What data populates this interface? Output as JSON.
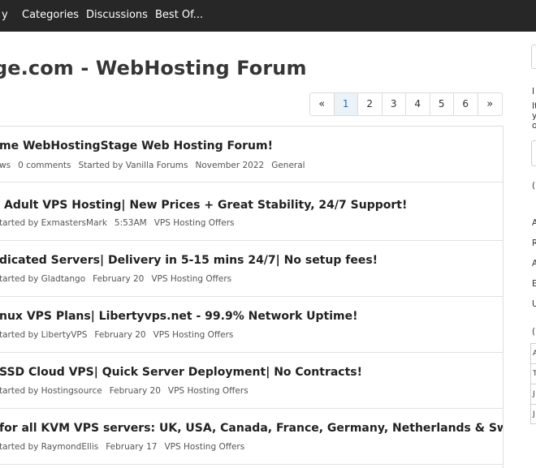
{
  "nav": {
    "items": [
      "y",
      "Categories",
      "Discussions",
      "Best Of..."
    ]
  },
  "page": {
    "title": "ge.com - WebHosting Forum"
  },
  "pager": {
    "prev": "«",
    "pages": [
      "1",
      "2",
      "3",
      "4",
      "5",
      "6"
    ],
    "next": "»",
    "current": "1"
  },
  "discussions": [
    {
      "title": "me WebHostingStage Web Hosting Forum!",
      "meta": [
        "ws",
        "0 comments",
        "Started by Vanilla Forums",
        "November 2022",
        "General"
      ]
    },
    {
      "title": "Adult VPS Hosting| New Prices + Great Stability, 24/7 Support!",
      "meta": [
        "tarted by ExmastersMark",
        "5:53AM",
        "VPS Hosting Offers"
      ]
    },
    {
      "title": "dicated Servers| Delivery in 5-15 mins 24/7| No setup fees!",
      "meta": [
        "tarted by Gladtango",
        "February 20",
        "VPS Hosting Offers"
      ]
    },
    {
      "title": "nux VPS Plans| Libertyvps.net - 99.9% Network Uptime!",
      "meta": [
        "tarted by LibertyVPS",
        "February 20",
        "VPS Hosting Offers"
      ]
    },
    {
      "title": "SSD Cloud VPS| Quick Server Deployment| No Contracts!",
      "meta": [
        "tarted by Hostingsource",
        "February 20",
        "VPS Hosting Offers"
      ]
    },
    {
      "title": "for all KVM VPS servers: UK, USA, Canada, France, Germany, Netherlands & Switzerla",
      "meta": [
        "tarted by RaymondEllis",
        "February 17",
        "VPS Hosting Offers"
      ]
    }
  ],
  "sidebar": {
    "text_fragments": [
      "I",
      "It",
      "y",
      "o",
      "(",
      "A",
      "R",
      "A",
      "E",
      "U",
      "("
    ],
    "table_rows": [
      "A",
      "T",
      "J",
      "J"
    ]
  },
  "colors": {
    "topbar": "#272727",
    "active_page_bg": "#ebf2f8",
    "active_page_text": "#1a73b8"
  }
}
